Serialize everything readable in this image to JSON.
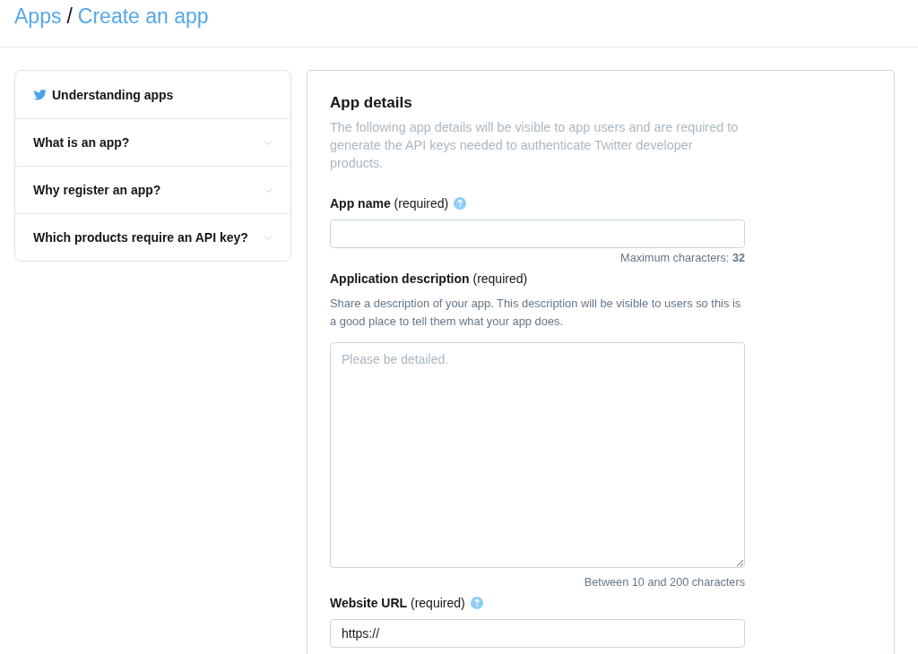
{
  "breadcrumb": {
    "items": [
      "Apps",
      "Create an app"
    ],
    "separator": "/"
  },
  "sidebar": {
    "title": "Understanding apps",
    "items": [
      {
        "label": "What is an app?",
        "expanded": false
      },
      {
        "label": "Why register an app?",
        "expanded": false
      },
      {
        "label": "Which products require an API key?",
        "expanded": false
      }
    ]
  },
  "form": {
    "title": "App details",
    "description": "The following app details will be visible to app users and are required to generate the API keys needed to authenticate Twitter developer products.",
    "fields": [
      {
        "kind": "input",
        "label": "**App name** (required)",
        "help": true,
        "hint": "Maximum characters: **32**"
      },
      {
        "kind": "textarea",
        "label": "**Application description** (required)",
        "help": false,
        "description": "Share a description of your app. This description will be visible to users so this is a good place to tell them what your app does.",
        "placeholder": "Please be detailed.",
        "hint": "Between 10 and 200 characters"
      },
      {
        "kind": "input",
        "label": "**Website URL** (required)",
        "help": true,
        "value": "https://"
      }
    ]
  }
}
